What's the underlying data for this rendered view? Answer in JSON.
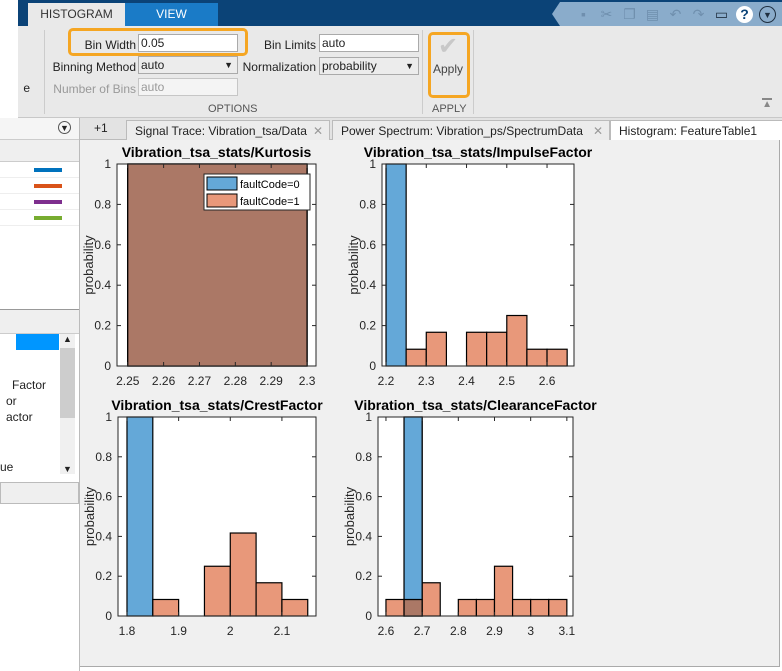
{
  "ribbon": {
    "tabs": [
      {
        "label": "HISTOGRAM",
        "active": true
      },
      {
        "label": "VIEW",
        "active": false
      }
    ],
    "bin_width_label": "Bin Width",
    "bin_width_value": "0.05",
    "bin_limits_label": "Bin Limits",
    "bin_limits_value": "auto",
    "binning_method_label": "Binning Method",
    "binning_method_value": "auto",
    "normalization_label": "Normalization",
    "normalization_value": "probability",
    "num_bins_label": "Number of Bins",
    "num_bins_value": "auto",
    "options_section": "OPTIONS",
    "apply_label": "Apply",
    "apply_section": "APPLY",
    "left_clipped_text": "e"
  },
  "quick_access": [
    "save-icon",
    "cut-icon",
    "copy-icon",
    "paste-icon",
    "undo-icon",
    "redo-icon",
    "window-layout-icon",
    "help-icon",
    "options-dropdown-icon"
  ],
  "doc_tabs": {
    "overflow": "+1",
    "tabs": [
      {
        "label": "Signal Trace: Vibration_tsa/Data",
        "active": false
      },
      {
        "label": "Power Spectrum: Vibration_ps/SpectrumData",
        "active": false
      },
      {
        "label": "Histogram: FeatureTable1",
        "active": true
      }
    ]
  },
  "left_panel": {
    "legend_colors": [
      "#0072bd",
      "#d95319",
      "#7e2f8e",
      "#77ac30"
    ],
    "list_items": [
      "Factor",
      "or",
      "actor",
      "ue"
    ],
    "selected_color": "#0096ff"
  },
  "colors": {
    "series0": "#64a8d8",
    "series1": "#e8987a",
    "overlap": "#ab7866",
    "highlight": "#f5a623"
  },
  "chart_data": [
    {
      "type": "bar",
      "title": "Vibration_tsa_stats/Kurtosis",
      "xlabel": "",
      "ylabel": "probability",
      "xlim": [
        2.247,
        2.3025
      ],
      "ylim": [
        0,
        1
      ],
      "xticks": [
        2.25,
        2.26,
        2.27,
        2.28,
        2.29,
        2.3
      ],
      "xticklabels": [
        "2.25",
        "2.26",
        "2.27",
        "2.28",
        "2.29",
        "2.3"
      ],
      "yticks": [
        0,
        0.2,
        0.4,
        0.6,
        0.8,
        1
      ],
      "yticklabels": [
        "0",
        "0.2",
        "0.4",
        "0.6",
        "0.8",
        "1"
      ],
      "bin_width": 0.05,
      "legend": {
        "placement": "top-right",
        "entries": [
          "faultCode=0",
          "faultCode=1"
        ]
      },
      "series": [
        {
          "name": "faultCode=0",
          "bin_edges_start": [
            2.25
          ],
          "values": [
            1
          ]
        },
        {
          "name": "faultCode=1",
          "bin_edges_start": [
            2.25
          ],
          "values": [
            1
          ]
        }
      ]
    },
    {
      "type": "bar",
      "title": "Vibration_tsa_stats/ImpulseFactor",
      "xlabel": "",
      "ylabel": "probability",
      "xlim": [
        2.19,
        2.667
      ],
      "ylim": [
        0,
        1
      ],
      "xticks": [
        2.2,
        2.3,
        2.4,
        2.5,
        2.6
      ],
      "xticklabels": [
        "2.2",
        "2.3",
        "2.4",
        "2.5",
        "2.6"
      ],
      "yticks": [
        0,
        0.2,
        0.4,
        0.6,
        0.8,
        1
      ],
      "yticklabels": [
        "0",
        "0.2",
        "0.4",
        "0.6",
        "0.8",
        "1"
      ],
      "bin_width": 0.05,
      "series": [
        {
          "name": "faultCode=0",
          "bin_edges_start": [
            2.2
          ],
          "values": [
            1
          ]
        },
        {
          "name": "faultCode=1",
          "bin_edges_start": [
            2.25,
            2.3,
            2.35,
            2.4,
            2.45,
            2.5,
            2.55,
            2.6
          ],
          "values": [
            0.083,
            0.167,
            0,
            0.167,
            0.167,
            0.25,
            0.083,
            0.083
          ]
        }
      ]
    },
    {
      "type": "bar",
      "title": "Vibration_tsa_stats/CrestFactor",
      "xlabel": "",
      "ylabel": "probability",
      "xlim": [
        1.7826,
        2.166
      ],
      "ylim": [
        0,
        1
      ],
      "xticks": [
        1.8,
        1.9,
        2,
        2.1
      ],
      "xticklabels": [
        "1.8",
        "1.9",
        "2",
        "2.1"
      ],
      "yticks": [
        0,
        0.2,
        0.4,
        0.6,
        0.8,
        1
      ],
      "yticklabels": [
        "0",
        "0.2",
        "0.4",
        "0.6",
        "0.8",
        "1"
      ],
      "bin_width": 0.05,
      "series": [
        {
          "name": "faultCode=0",
          "bin_edges_start": [
            1.8
          ],
          "values": [
            1
          ]
        },
        {
          "name": "faultCode=1",
          "bin_edges_start": [
            1.85,
            1.9,
            1.95,
            2.0,
            2.05,
            2.1
          ],
          "values": [
            0.083,
            0,
            0.25,
            0.417,
            0.167,
            0.083
          ]
        }
      ]
    },
    {
      "type": "bar",
      "title": "Vibration_tsa_stats/ClearanceFactor",
      "xlabel": "",
      "ylabel": "probability",
      "xlim": [
        2.578,
        3.117
      ],
      "ylim": [
        0,
        1
      ],
      "xticks": [
        2.6,
        2.7,
        2.8,
        2.9,
        3,
        3.1
      ],
      "xticklabels": [
        "2.6",
        "2.7",
        "2.8",
        "2.9",
        "3",
        "3.1"
      ],
      "yticks": [
        0,
        0.2,
        0.4,
        0.6,
        0.8,
        1
      ],
      "yticklabels": [
        "0",
        "0.2",
        "0.4",
        "0.6",
        "0.8",
        "1"
      ],
      "bin_width": 0.05,
      "series": [
        {
          "name": "faultCode=0",
          "bin_edges_start": [
            2.65
          ],
          "values": [
            1
          ]
        },
        {
          "name": "faultCode=1",
          "bin_edges_start": [
            2.6,
            2.65,
            2.7,
            2.75,
            2.8,
            2.85,
            2.9,
            2.95,
            3.0,
            3.05
          ],
          "values": [
            0.083,
            0.083,
            0.167,
            0,
            0.083,
            0.083,
            0.25,
            0.083,
            0.083,
            0.083
          ]
        }
      ]
    }
  ]
}
